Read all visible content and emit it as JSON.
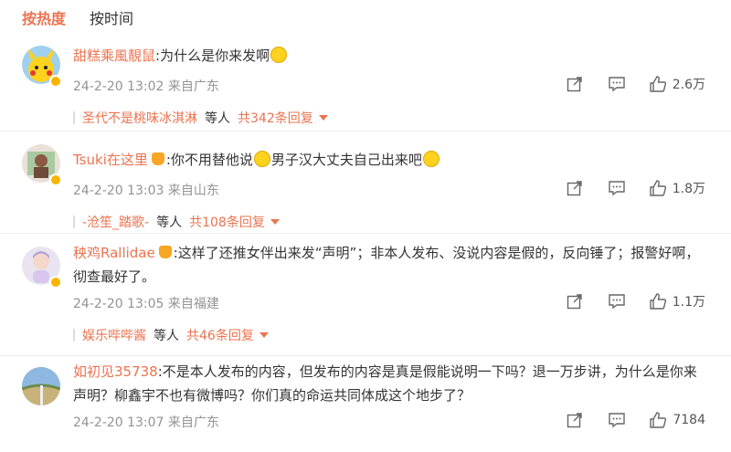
{
  "tabs": [
    {
      "label": "按热度",
      "active": true
    },
    {
      "label": "按时间",
      "active": false
    }
  ],
  "comments": [
    {
      "name": "甜糕乘風靚鼠",
      "text_parts": [
        ":为什么是你来发啊"
      ],
      "emojis_after": [
        "laugh-cry-emoji"
      ],
      "time": "24-2-20 13:02",
      "location": "来自广东",
      "likes": "2.6万",
      "reply_from": "圣代不是桃味冰淇淋",
      "reply_mid": "等人",
      "reply_count": "共342条回复"
    },
    {
      "name": "Tsuki在这里",
      "text_a": ":你不用替他说",
      "text_b": "男子汉大丈夫自己出来吧",
      "time": "24-2-20 13:03",
      "location": "来自山东",
      "likes": "1.8万",
      "reply_from": "-沧笙_踏歌-",
      "reply_mid": "等人",
      "reply_count": "共108条回复"
    },
    {
      "name": "秧鸡Rallidae",
      "text": ":这样了还推女伴出来发“声明”；非本人发布、没说内容是假的，反向锤了；报警好啊，彻查最好了。",
      "time": "24-2-20 13:05",
      "location": "来自福建",
      "likes": "1.1万",
      "reply_from": "娱乐哔哔酱",
      "reply_mid": "等人",
      "reply_count": "共46条回复"
    },
    {
      "name": "如初见35738",
      "text": ":不是本人发布的内容，但发布的内容是真是假能说明一下吗？退一万步讲，为什么是你来声明？柳鑫宇不也有微博吗？你们真的命运共同体成这个地步了？",
      "time": "24-2-20 13:07",
      "location": "来自广东",
      "likes": "7184"
    }
  ],
  "colors": {
    "accent": "#eb7350",
    "meta": "#939393",
    "text": "#333333"
  }
}
